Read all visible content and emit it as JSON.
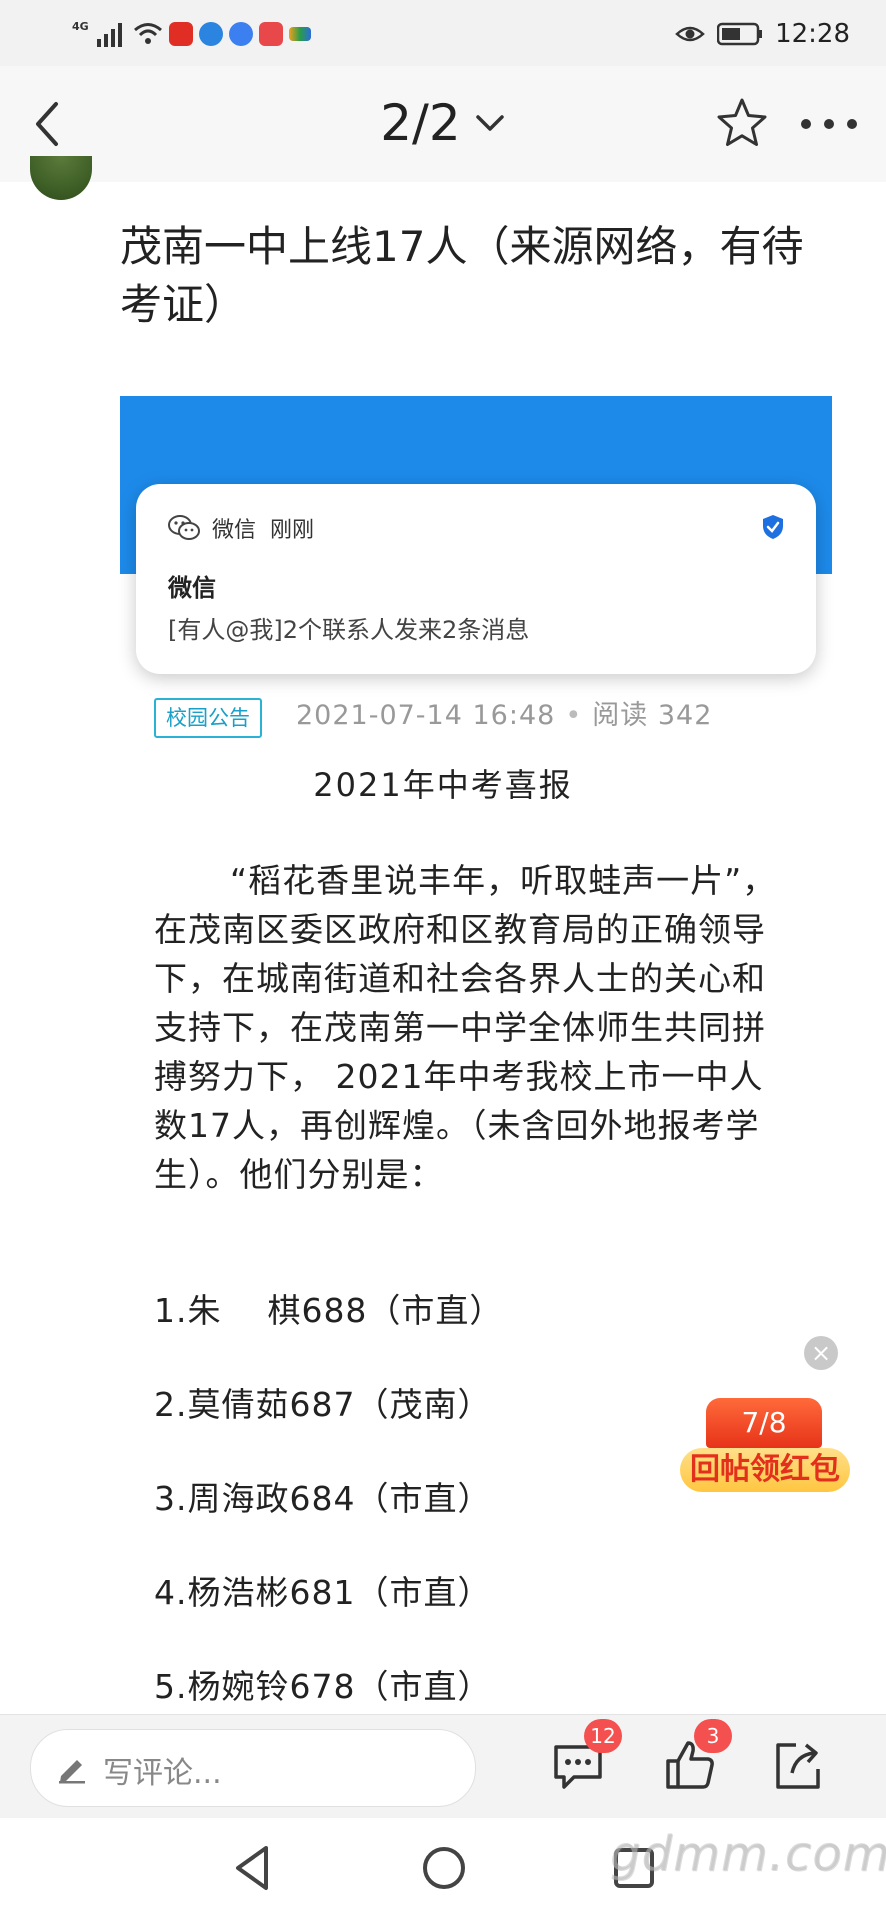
{
  "status_bar": {
    "network": "4G",
    "time": "12:28"
  },
  "nav": {
    "page_counter": "2/2"
  },
  "post": {
    "title": "茂南一中上线17人（来源网络，有待考证）"
  },
  "notification": {
    "app_name": "微信",
    "time": "刚刚",
    "title": "微信",
    "message": "[有人@我]2个联系人发来2条消息"
  },
  "meta": {
    "tag": "校园公告",
    "datetime": "2021-07-14 16:48",
    "read_label": "阅读 342"
  },
  "article": {
    "heading": "2021年中考喜报",
    "intro": "“稻花香里说丰年，听取蛙声一片”，在茂南区委区政府和区教育局的正确领导下，在城南街道和社会各界人士的关心和支持下，在茂南第一中学全体师生共同拼搏努力下， 2021年中考我校上市一中人数17人，再创辉煌。（未含回外地报考学生）。他们分别是：",
    "list": [
      "1.朱    棋688（市直）",
      "2.莫倩茹687（茂南）",
      "3.周海政684（市直）",
      "4.杨浩彬681（市直）",
      "5.杨婉铃678（市直）"
    ]
  },
  "floating": {
    "close": "×",
    "progress": "7/8",
    "label": "回帖领红包"
  },
  "bottom_bar": {
    "comment_placeholder": "写评论...",
    "comment_count": "12",
    "like_count": "3"
  },
  "watermark": "gdmm.com",
  "colors": {
    "banner_blue": "#1d8aea",
    "tag_cyan": "#2bb0d6",
    "badge_red": "#f45050",
    "packet_red": "#e6331a",
    "packet_yellow": "#ffc640"
  }
}
